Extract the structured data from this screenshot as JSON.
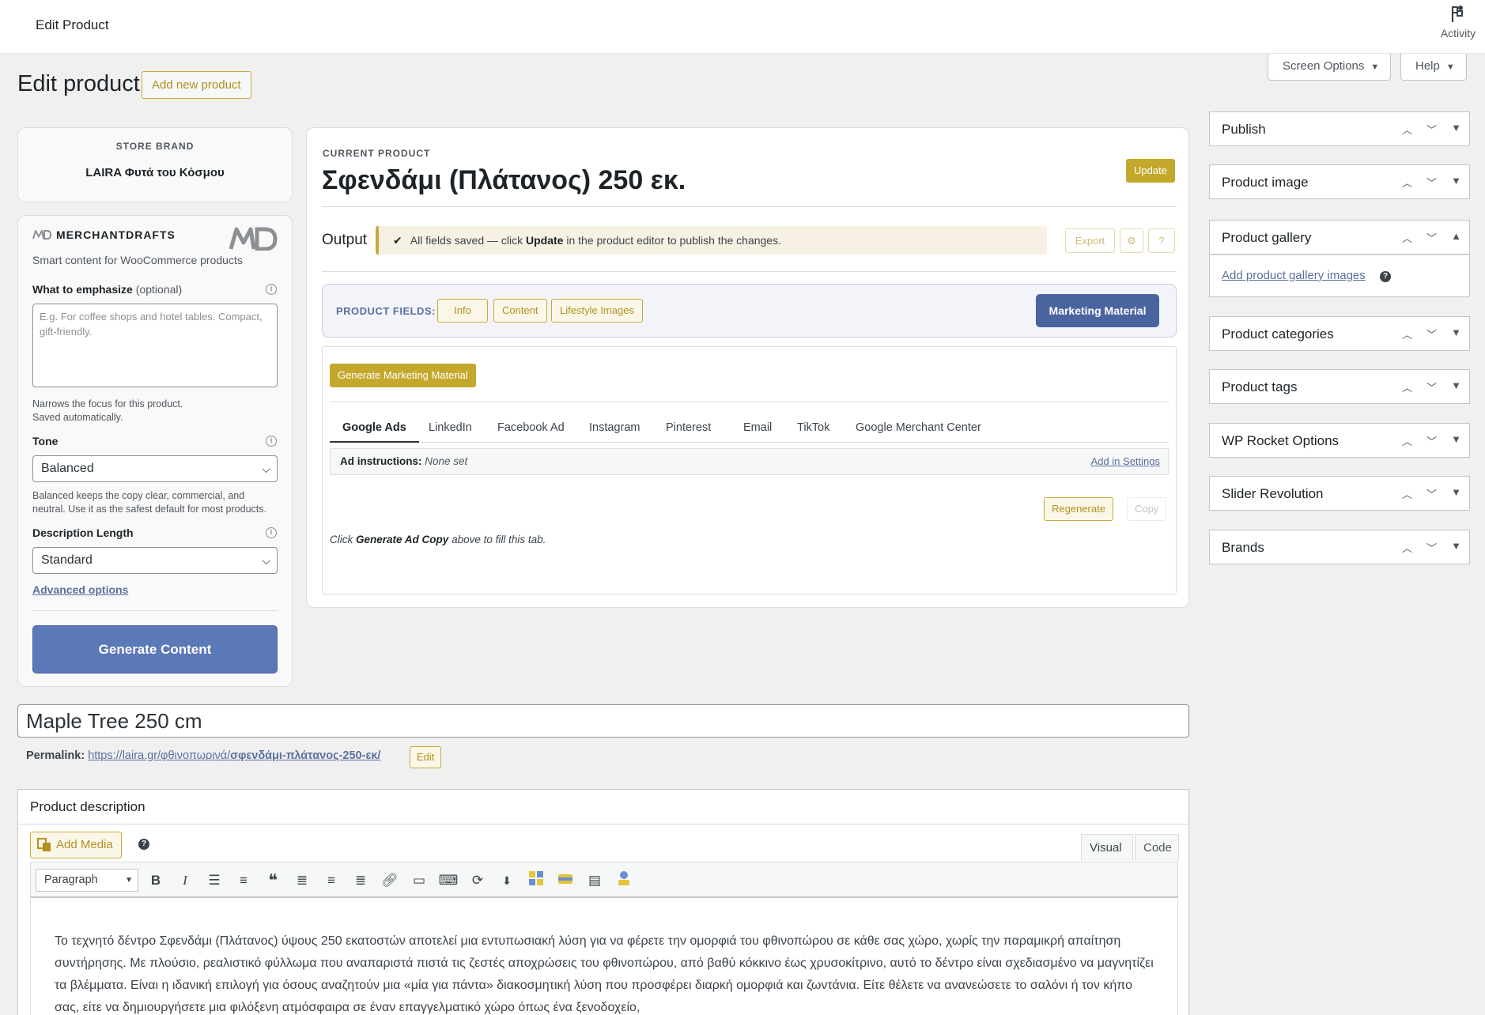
{
  "header": {
    "title": "Edit Product",
    "activity_label": "Activity"
  },
  "screen_options": {
    "screen_options_label": "Screen Options",
    "help_label": "Help"
  },
  "page": {
    "heading": "Edit product",
    "add_new_label": "Add new product"
  },
  "store": {
    "label": "STORE BRAND",
    "brand": "LAIRA Φυτά του Κόσμου"
  },
  "merchantdrafts": {
    "name": "MERCHANTDRAFTS",
    "tagline": "Smart content for WooCommerce products",
    "emphasize_label": "What to emphasize",
    "emphasize_optional": "(optional)",
    "emphasize_placeholder": "E.g. For coffee shops and hotel tables. Compact, gift-friendly.",
    "emphasize_hint_1": "Narrows the focus for this product.",
    "emphasize_hint_2": "Saved automatically.",
    "tone_label": "Tone",
    "tone_value": "Balanced",
    "tone_hint_1": "Balanced keeps the copy clear, commercial, and",
    "tone_hint_2": "neutral. Use it as the safest default for most products.",
    "length_label": "Description Length",
    "length_value": "Standard",
    "advanced_label": "Advanced options",
    "generate_label": "Generate Content"
  },
  "current": {
    "label": "CURRENT PRODUCT",
    "title": "Σφενδάμι (Πλάτανος) 250 εκ.",
    "update_label": "Update",
    "output_label": "Output",
    "notice_pre": "All fields saved — click",
    "notice_bold": "Update",
    "notice_post": "in the product editor to publish the changes.",
    "export_label": "Export",
    "gear_label": "⚙",
    "help_label": "?"
  },
  "product_fields": {
    "label": "PRODUCT FIELDS:",
    "buttons": [
      "Info",
      "Content",
      "Lifestyle Images"
    ],
    "active_label": "Marketing Material"
  },
  "marketing": {
    "generate_label": "Generate Marketing Material",
    "tabs": [
      "Google Ads",
      "LinkedIn",
      "Facebook Ad",
      "Instagram",
      "Pinterest",
      "Email",
      "TikTok",
      "Google Merchant Center"
    ],
    "instr_label": "Ad instructions:",
    "instr_value": "None set",
    "instr_link": "Add in Settings",
    "regenerate_label": "Regenerate",
    "copy_label": "Copy",
    "hint_pre": "Click",
    "hint_bold": "Generate Ad Copy",
    "hint_post": "above to fill this tab."
  },
  "sidebar": {
    "boxes": [
      "Publish",
      "Product image",
      "Product gallery",
      "Product categories",
      "Product tags",
      "WP Rocket Options",
      "Slider Revolution",
      "Brands"
    ],
    "gallery_link": "Add product gallery images"
  },
  "post": {
    "title_value": "Maple Tree 250 cm",
    "permalink_label": "Permalink:",
    "permalink_base": "https://laira.gr/φθινοπωρινά/",
    "permalink_slug": "σφενδάμι-πλάτανος-250-εκ/",
    "edit_label": "Edit"
  },
  "description": {
    "title": "Product description",
    "add_media_label": "Add Media",
    "visual_label": "Visual",
    "code_label": "Code",
    "format_value": "Paragraph",
    "text": "Το τεχνητό δέντρο Σφενδάμι (Πλάτανος) ύψους 250 εκατοστών αποτελεί μια εντυπωσιακή λύση για να φέρετε την ομορφιά του φθινοπώρου σε κάθε σας χώρο, χωρίς την παραμικρή απαίτηση συντήρησης. Με πλούσιο, ρεαλιστικό φύλλωμα που αναπαριστά πιστά τις ζεστές αποχρώσεις του φθινοπώρου, από βαθύ κόκκινο έως χρυσοκίτρινο, αυτό το δέντρο είναι σχεδιασμένο να μαγνητίζει τα βλέμματα. Είναι η ιδανική επιλογή για όσους αναζητούν μια «μία για πάντα» διακοσμητική λύση που προσφέρει διαρκή ομορφιά και ζωντάνια. Είτε θέλετε να ανανεώσετε το σαλόνι ή τον κήπο σας, είτε να δημιουργήσετε μια φιλόξενη ατμόσφαιρα σε έναν επαγγελματικό χώρο όπως ένα ξενοδοχείο,"
  },
  "colors": {
    "accent_gold": "#c4a82c",
    "accent_blue": "#5b78b7",
    "background": "#f0f0f1"
  }
}
